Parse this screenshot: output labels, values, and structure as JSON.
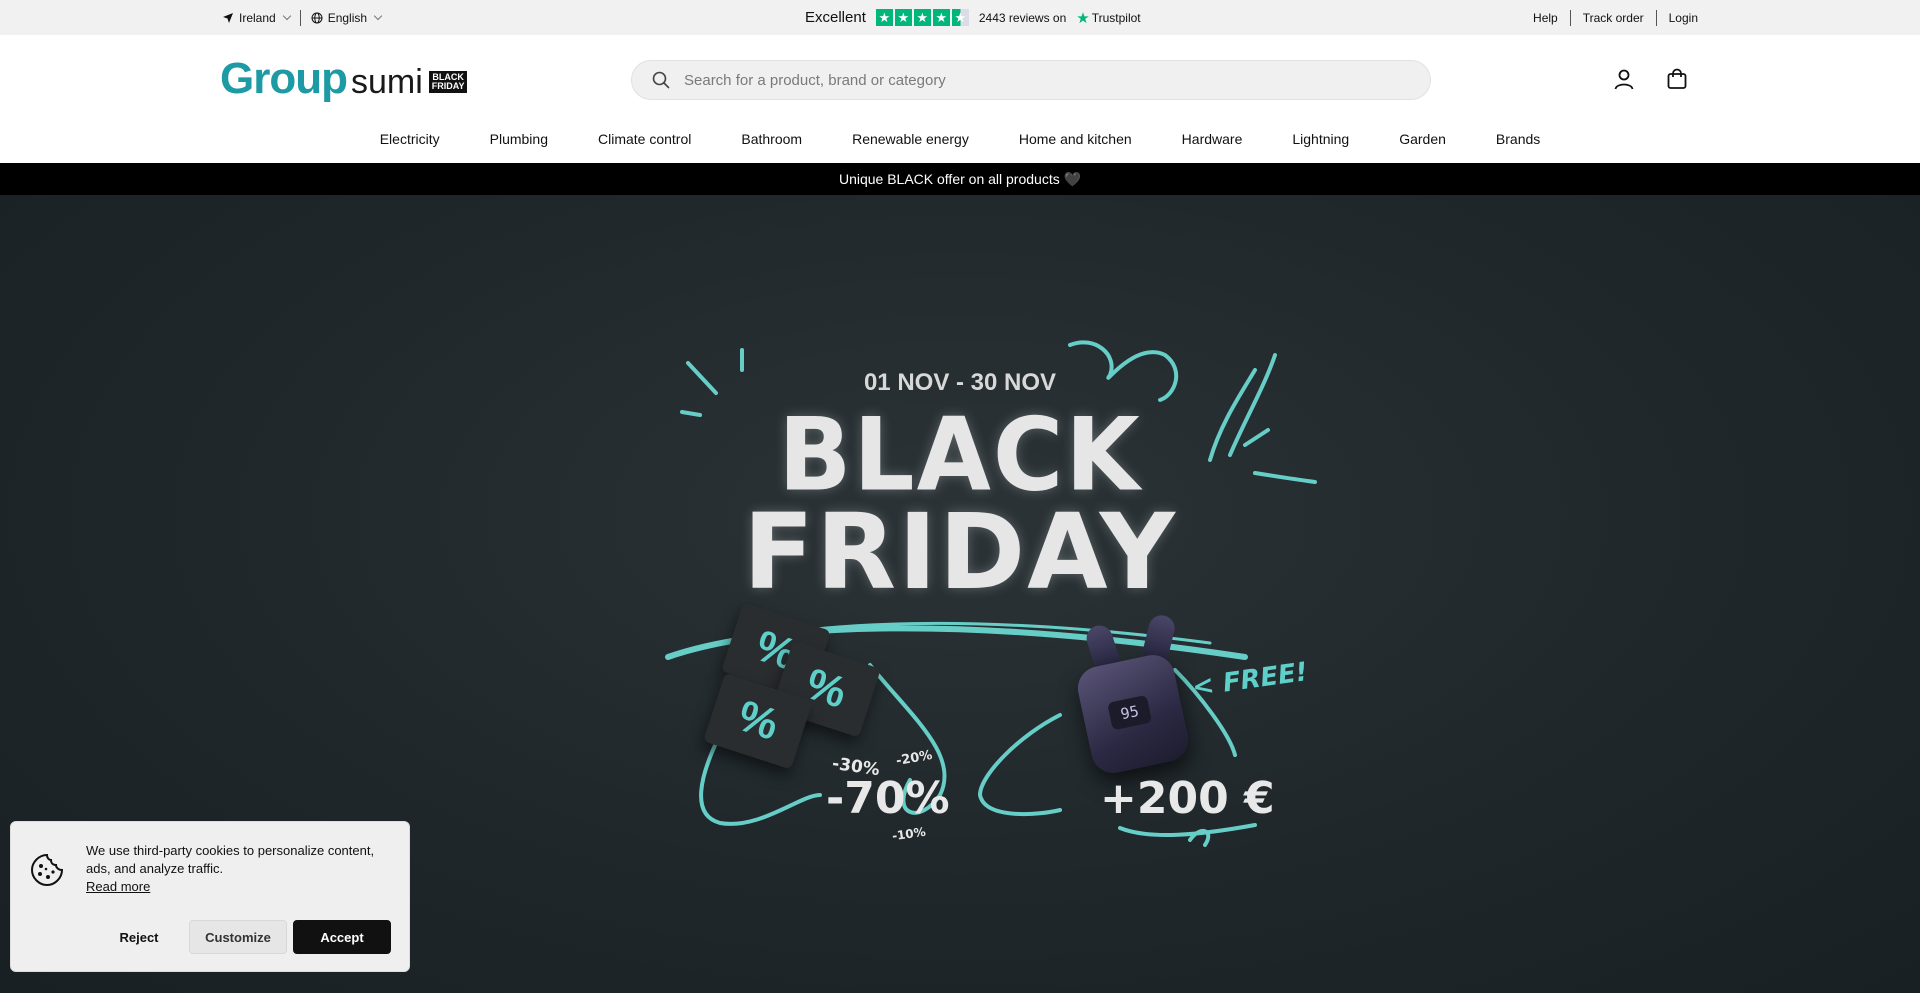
{
  "topbar": {
    "country": "Ireland",
    "language": "English",
    "trustpilot": {
      "rating_label": "Excellent",
      "reviews_text": "2443 reviews on",
      "brand": "Trustpilot",
      "stars": 4.5,
      "star_color": "#00b67a"
    },
    "links": [
      "Help",
      "Track order",
      "Login"
    ]
  },
  "header": {
    "logo": {
      "word1": "Group",
      "word2": "sumi",
      "badge_line1": "BLACK",
      "badge_line2": "FRIDAY"
    },
    "search_placeholder": "Search for a product, brand or category",
    "icons": [
      "user-icon",
      "cart-icon"
    ]
  },
  "nav": {
    "items": [
      "Electricity",
      "Plumbing",
      "Climate control",
      "Bathroom",
      "Renewable energy",
      "Home and kitchen",
      "Hardware",
      "Lightning",
      "Garden",
      "Brands"
    ]
  },
  "promo_strip": {
    "text": "Unique BLACK offer on all products 🖤"
  },
  "hero": {
    "date_range": "01 NOV - 30 NOV",
    "title_line1": "BLACK",
    "title_line2": "FRIDAY",
    "percent_symbol": "%",
    "discounts": {
      "small1": "-30%",
      "small2": "-20%",
      "big": "-70%",
      "small3": "-10%"
    },
    "gift": {
      "free_label": "< FREE!",
      "amount": "+200 €",
      "display": "95"
    },
    "accent_color": "#5fd0c9"
  },
  "cookie": {
    "text": "We use third-party cookies to personalize content, ads, and analyze traffic.",
    "read_more": "Read more",
    "reject": "Reject",
    "customize": "Customize",
    "accept": "Accept"
  },
  "colors": {
    "brand_teal": "#1d9aa3",
    "topbar_bg": "#f1f1f1",
    "promo_bg": "#000000"
  }
}
